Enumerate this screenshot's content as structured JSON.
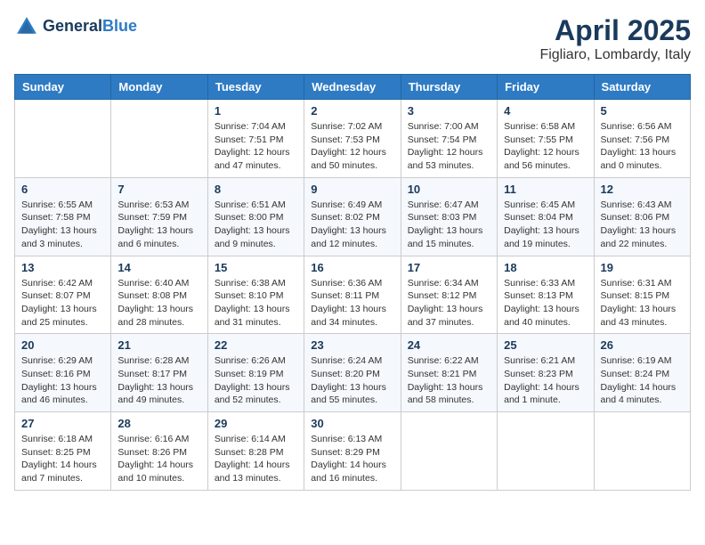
{
  "header": {
    "logo_general": "General",
    "logo_blue": "Blue",
    "month": "April 2025",
    "location": "Figliaro, Lombardy, Italy"
  },
  "days_of_week": [
    "Sunday",
    "Monday",
    "Tuesday",
    "Wednesday",
    "Thursday",
    "Friday",
    "Saturday"
  ],
  "weeks": [
    [
      {
        "day": "",
        "sunrise": "",
        "sunset": "",
        "daylight": ""
      },
      {
        "day": "",
        "sunrise": "",
        "sunset": "",
        "daylight": ""
      },
      {
        "day": "1",
        "sunrise": "Sunrise: 7:04 AM",
        "sunset": "Sunset: 7:51 PM",
        "daylight": "Daylight: 12 hours and 47 minutes."
      },
      {
        "day": "2",
        "sunrise": "Sunrise: 7:02 AM",
        "sunset": "Sunset: 7:53 PM",
        "daylight": "Daylight: 12 hours and 50 minutes."
      },
      {
        "day": "3",
        "sunrise": "Sunrise: 7:00 AM",
        "sunset": "Sunset: 7:54 PM",
        "daylight": "Daylight: 12 hours and 53 minutes."
      },
      {
        "day": "4",
        "sunrise": "Sunrise: 6:58 AM",
        "sunset": "Sunset: 7:55 PM",
        "daylight": "Daylight: 12 hours and 56 minutes."
      },
      {
        "day": "5",
        "sunrise": "Sunrise: 6:56 AM",
        "sunset": "Sunset: 7:56 PM",
        "daylight": "Daylight: 13 hours and 0 minutes."
      }
    ],
    [
      {
        "day": "6",
        "sunrise": "Sunrise: 6:55 AM",
        "sunset": "Sunset: 7:58 PM",
        "daylight": "Daylight: 13 hours and 3 minutes."
      },
      {
        "day": "7",
        "sunrise": "Sunrise: 6:53 AM",
        "sunset": "Sunset: 7:59 PM",
        "daylight": "Daylight: 13 hours and 6 minutes."
      },
      {
        "day": "8",
        "sunrise": "Sunrise: 6:51 AM",
        "sunset": "Sunset: 8:00 PM",
        "daylight": "Daylight: 13 hours and 9 minutes."
      },
      {
        "day": "9",
        "sunrise": "Sunrise: 6:49 AM",
        "sunset": "Sunset: 8:02 PM",
        "daylight": "Daylight: 13 hours and 12 minutes."
      },
      {
        "day": "10",
        "sunrise": "Sunrise: 6:47 AM",
        "sunset": "Sunset: 8:03 PM",
        "daylight": "Daylight: 13 hours and 15 minutes."
      },
      {
        "day": "11",
        "sunrise": "Sunrise: 6:45 AM",
        "sunset": "Sunset: 8:04 PM",
        "daylight": "Daylight: 13 hours and 19 minutes."
      },
      {
        "day": "12",
        "sunrise": "Sunrise: 6:43 AM",
        "sunset": "Sunset: 8:06 PM",
        "daylight": "Daylight: 13 hours and 22 minutes."
      }
    ],
    [
      {
        "day": "13",
        "sunrise": "Sunrise: 6:42 AM",
        "sunset": "Sunset: 8:07 PM",
        "daylight": "Daylight: 13 hours and 25 minutes."
      },
      {
        "day": "14",
        "sunrise": "Sunrise: 6:40 AM",
        "sunset": "Sunset: 8:08 PM",
        "daylight": "Daylight: 13 hours and 28 minutes."
      },
      {
        "day": "15",
        "sunrise": "Sunrise: 6:38 AM",
        "sunset": "Sunset: 8:10 PM",
        "daylight": "Daylight: 13 hours and 31 minutes."
      },
      {
        "day": "16",
        "sunrise": "Sunrise: 6:36 AM",
        "sunset": "Sunset: 8:11 PM",
        "daylight": "Daylight: 13 hours and 34 minutes."
      },
      {
        "day": "17",
        "sunrise": "Sunrise: 6:34 AM",
        "sunset": "Sunset: 8:12 PM",
        "daylight": "Daylight: 13 hours and 37 minutes."
      },
      {
        "day": "18",
        "sunrise": "Sunrise: 6:33 AM",
        "sunset": "Sunset: 8:13 PM",
        "daylight": "Daylight: 13 hours and 40 minutes."
      },
      {
        "day": "19",
        "sunrise": "Sunrise: 6:31 AM",
        "sunset": "Sunset: 8:15 PM",
        "daylight": "Daylight: 13 hours and 43 minutes."
      }
    ],
    [
      {
        "day": "20",
        "sunrise": "Sunrise: 6:29 AM",
        "sunset": "Sunset: 8:16 PM",
        "daylight": "Daylight: 13 hours and 46 minutes."
      },
      {
        "day": "21",
        "sunrise": "Sunrise: 6:28 AM",
        "sunset": "Sunset: 8:17 PM",
        "daylight": "Daylight: 13 hours and 49 minutes."
      },
      {
        "day": "22",
        "sunrise": "Sunrise: 6:26 AM",
        "sunset": "Sunset: 8:19 PM",
        "daylight": "Daylight: 13 hours and 52 minutes."
      },
      {
        "day": "23",
        "sunrise": "Sunrise: 6:24 AM",
        "sunset": "Sunset: 8:20 PM",
        "daylight": "Daylight: 13 hours and 55 minutes."
      },
      {
        "day": "24",
        "sunrise": "Sunrise: 6:22 AM",
        "sunset": "Sunset: 8:21 PM",
        "daylight": "Daylight: 13 hours and 58 minutes."
      },
      {
        "day": "25",
        "sunrise": "Sunrise: 6:21 AM",
        "sunset": "Sunset: 8:23 PM",
        "daylight": "Daylight: 14 hours and 1 minute."
      },
      {
        "day": "26",
        "sunrise": "Sunrise: 6:19 AM",
        "sunset": "Sunset: 8:24 PM",
        "daylight": "Daylight: 14 hours and 4 minutes."
      }
    ],
    [
      {
        "day": "27",
        "sunrise": "Sunrise: 6:18 AM",
        "sunset": "Sunset: 8:25 PM",
        "daylight": "Daylight: 14 hours and 7 minutes."
      },
      {
        "day": "28",
        "sunrise": "Sunrise: 6:16 AM",
        "sunset": "Sunset: 8:26 PM",
        "daylight": "Daylight: 14 hours and 10 minutes."
      },
      {
        "day": "29",
        "sunrise": "Sunrise: 6:14 AM",
        "sunset": "Sunset: 8:28 PM",
        "daylight": "Daylight: 14 hours and 13 minutes."
      },
      {
        "day": "30",
        "sunrise": "Sunrise: 6:13 AM",
        "sunset": "Sunset: 8:29 PM",
        "daylight": "Daylight: 14 hours and 16 minutes."
      },
      {
        "day": "",
        "sunrise": "",
        "sunset": "",
        "daylight": ""
      },
      {
        "day": "",
        "sunrise": "",
        "sunset": "",
        "daylight": ""
      },
      {
        "day": "",
        "sunrise": "",
        "sunset": "",
        "daylight": ""
      }
    ]
  ]
}
